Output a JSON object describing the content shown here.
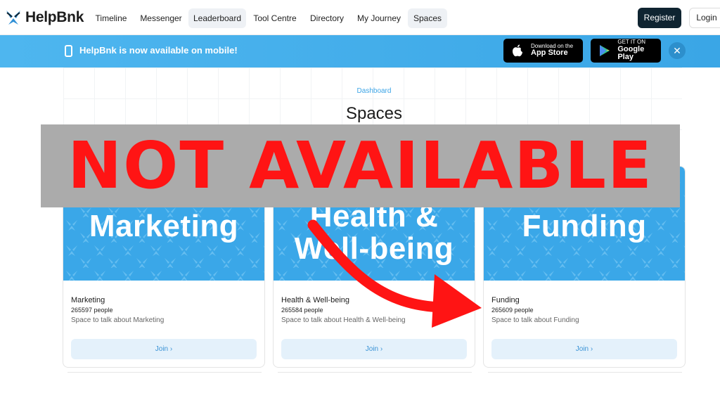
{
  "brand": {
    "name": "HelpBnk",
    "accent": "#3aa7e8",
    "dark": "#0f2431"
  },
  "nav": {
    "items": [
      {
        "label": "Timeline"
      },
      {
        "label": "Messenger"
      },
      {
        "label": "Leaderboard"
      },
      {
        "label": "Tool Centre"
      },
      {
        "label": "Directory"
      },
      {
        "label": "My Journey"
      },
      {
        "label": "Spaces"
      }
    ],
    "register_label": "Register",
    "login_label": "Login"
  },
  "banner": {
    "text": "HelpBnk is now available on mobile!",
    "app_store": {
      "line1": "Download on the",
      "line2": "App Store",
      "icon": "apple-icon"
    },
    "google_play": {
      "line1": "GET IT ON",
      "line2": "Google Play",
      "icon": "play-icon"
    },
    "close_icon": "close-icon"
  },
  "header": {
    "breadcrumb": "Dashboard",
    "title": "Spaces"
  },
  "overlay": {
    "text": "NOT AVAILABLE",
    "color": "#ff1414"
  },
  "spaces": [
    {
      "image_text": "Marketing",
      "name": "Marketing",
      "people": "265597 people",
      "description": "Space to talk about Marketing",
      "join_label": "Join ›"
    },
    {
      "image_text_1": "Health &",
      "image_text_2": "Well-being",
      "name": "Health & Well-being",
      "people": "265584 people",
      "description": "Space to talk about Health & Well-being",
      "join_label": "Join ›"
    },
    {
      "image_text": "Funding",
      "name": "Funding",
      "people": "265609 people",
      "description": "Space to talk about Funding",
      "join_label": "Join ›"
    }
  ]
}
